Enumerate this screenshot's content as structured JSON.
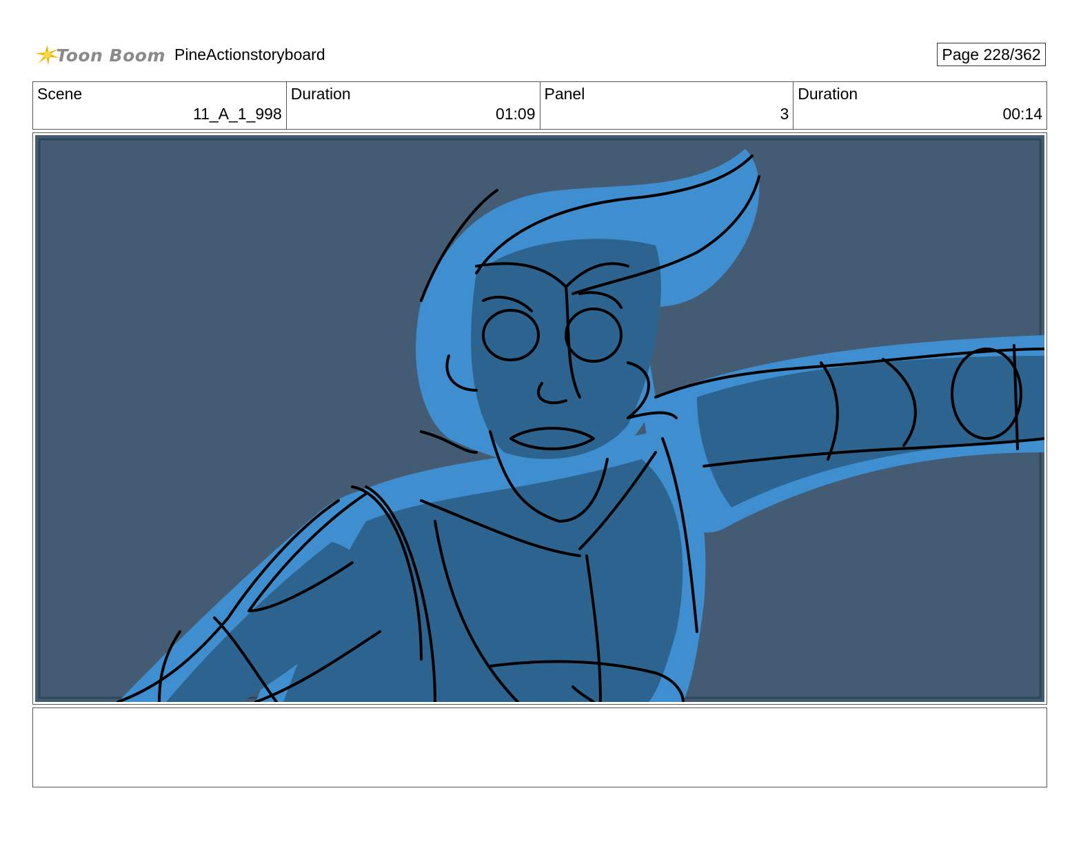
{
  "header": {
    "logo_text": "Toon Boom",
    "project_title": "PineActionstoryboard",
    "page_label": "Page 228/362"
  },
  "info": {
    "scene_label": "Scene",
    "scene_value": "11_A_1_998",
    "scene_duration_label": "Duration",
    "scene_duration_value": "01:09",
    "panel_label": "Panel",
    "panel_value": "3",
    "panel_duration_label": "Duration",
    "panel_duration_value": "00:14"
  },
  "colors": {
    "background": "#445c73",
    "character_light": "#3f8fd0",
    "character_dark": "#2c638f",
    "line": "#000000",
    "logo_yellow": "#f5b800"
  },
  "notes": {
    "text": ""
  }
}
